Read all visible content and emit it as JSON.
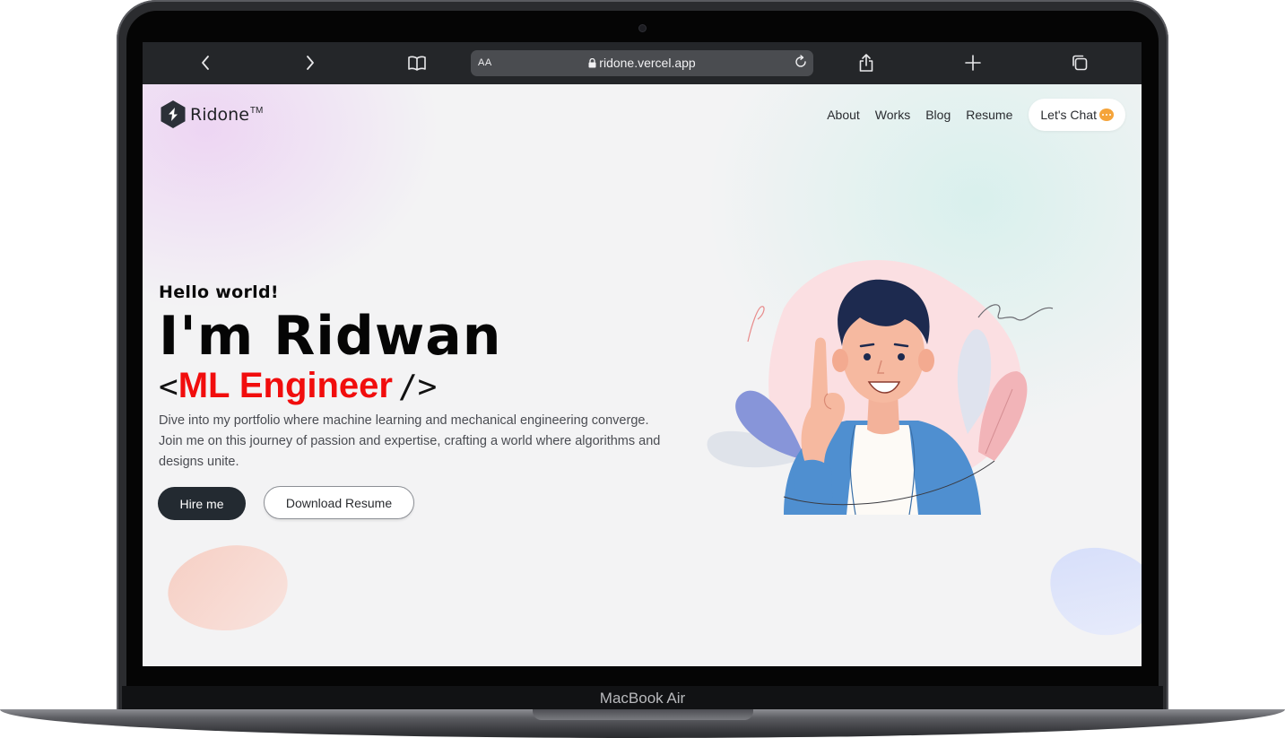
{
  "device": {
    "label": "MacBook Air"
  },
  "browser": {
    "text_size_label": "AA",
    "url": "ridone.vercel.app",
    "icons": [
      "chevron-left-icon",
      "chevron-right-icon",
      "book-icon",
      "lock-icon",
      "reload-icon",
      "share-icon",
      "plus-icon",
      "tabs-icon"
    ]
  },
  "site": {
    "logo": {
      "name": "Ridone",
      "tm": "TM"
    },
    "nav": {
      "items": [
        "About",
        "Works",
        "Blog",
        "Resume"
      ],
      "chat_label": "Let's Chat"
    },
    "hero": {
      "greeting": "Hello world!",
      "name": "I'm Ridwan",
      "role_open": "<",
      "role": "ML Engineer",
      "role_close": "/>",
      "description": "Dive into my portfolio where machine learning and mechanical engineering converge. Join me on this journey of passion and expertise, crafting a world where algorithms and designs unite.",
      "hire_label": "Hire me",
      "download_label": "Download Resume"
    }
  },
  "colors": {
    "accent_red": "#f10d0d",
    "button_dark": "#232a31",
    "chat_bubble": "#f5a43a",
    "toolbar": "#242629"
  }
}
